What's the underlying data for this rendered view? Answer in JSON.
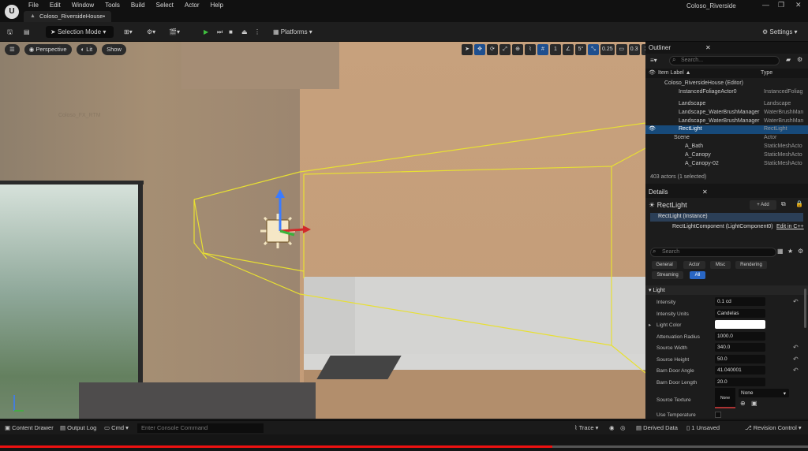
{
  "menubar": {
    "items": [
      "File",
      "Edit",
      "Window",
      "Tools",
      "Build",
      "Select",
      "Actor",
      "Help"
    ],
    "doc_tab": "Coloso_RiversideHouse•",
    "window_title": "Coloso_Riverside",
    "logo_letter": "U"
  },
  "toolbar": {
    "selection_mode": "Selection Mode",
    "platforms": "Platforms",
    "settings": "Settings"
  },
  "viewport": {
    "perspective": "Perspective",
    "lit": "Lit",
    "show": "Show",
    "snap_grid": "1",
    "snap_rot": "5°",
    "snap_scale": "0.25",
    "cam_speed": "0.3",
    "watermark": "Coloso_FX_RTM"
  },
  "outliner": {
    "title": "Outliner",
    "search_placeholder": "Search...",
    "col_label": "Item Label ▲",
    "col_type": "Type",
    "rows": [
      {
        "label": "Coloso_RiversideHouse (Editor)",
        "type": ""
      },
      {
        "label": "InstancedFoliageActor0",
        "type": "InstancedFoliag"
      },
      {
        "label": "Landscape",
        "type": "Landscape"
      },
      {
        "label": "Landscape_WaterBrushManager",
        "type": "WaterBrushMan"
      },
      {
        "label": "Landscape_WaterBrushManager",
        "type": "WaterBrushMan"
      },
      {
        "label": "RectLight",
        "type": "RectLight"
      },
      {
        "label": "Scene",
        "type": "Actor"
      },
      {
        "label": "A_Bath",
        "type": "StaticMeshActo"
      },
      {
        "label": "A_Canopy",
        "type": "StaticMeshActo"
      },
      {
        "label": "A_Canopy-02",
        "type": "StaticMeshActo"
      }
    ],
    "footer": "403 actors (1 selected)"
  },
  "details": {
    "title": "Details",
    "actor_name": "RectLight",
    "add": "Add",
    "instance": "RectLight (Instance)",
    "component": "RectLightComponent (LightComponent0)",
    "edit_in": "Edit in C++",
    "search_placeholder": "Search",
    "filters": [
      "General",
      "Actor",
      "Misc",
      "Rendering",
      "Streaming",
      "All"
    ],
    "section": "Light",
    "props": [
      {
        "label": "Intensity",
        "value": "0.1 cd"
      },
      {
        "label": "Intensity Units",
        "value": "Candelas"
      },
      {
        "label": "Light Color",
        "value": ""
      },
      {
        "label": "Attenuation Radius",
        "value": "1000.0"
      },
      {
        "label": "Source Width",
        "value": "340.0"
      },
      {
        "label": "Source Height",
        "value": "50.0"
      },
      {
        "label": "Barn Door Angle",
        "value": "41.040001"
      },
      {
        "label": "Barn Door Length",
        "value": "20.0"
      }
    ],
    "source_texture": "Source Texture",
    "texture_none": "None",
    "texture_select": "None",
    "use_temperature": "Use Temperature"
  },
  "statusbar": {
    "content_drawer": "Content Drawer",
    "output_log": "Output Log",
    "cmd": "Cmd",
    "console_placeholder": "Enter Console Command",
    "trace": "Trace",
    "derived": "Derived Data",
    "unsaved": "1 Unsaved",
    "revision": "Revision Control"
  }
}
